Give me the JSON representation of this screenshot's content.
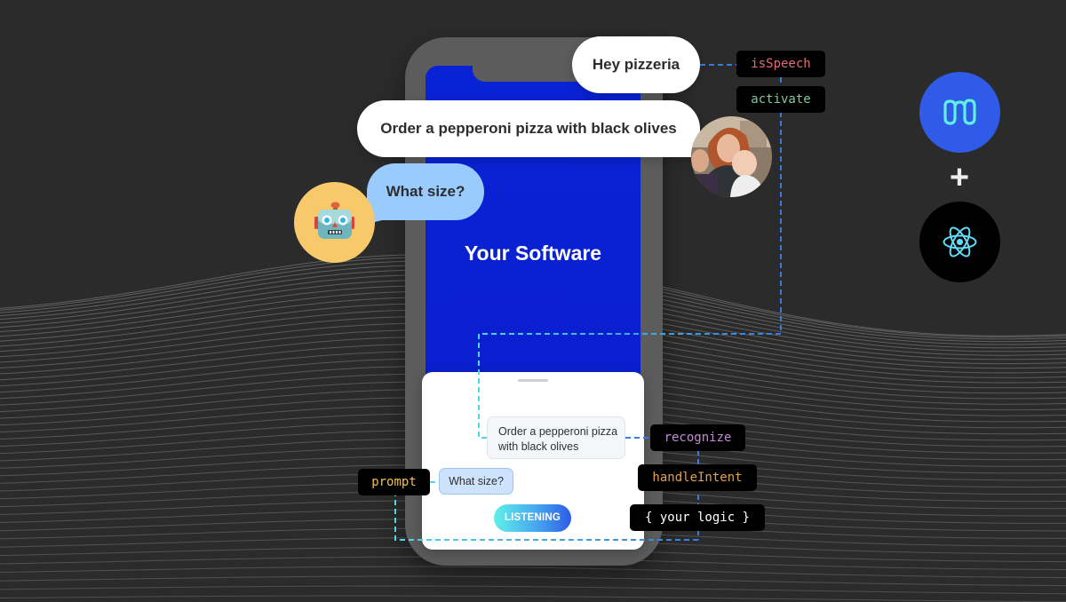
{
  "colors": {
    "background": "#2b2b2b",
    "phone_frame": "#5c5c5c",
    "screen": "#0a22d6",
    "bubble_user": "#ffffff",
    "bubble_bot": "#9acbff",
    "robot_avatar": "#f7c96a",
    "tag_bg": "#000000",
    "isSpeech": "#e06c75",
    "activate": "#7fc99a",
    "recognize": "#c38ad6",
    "handleIntent": "#e3a24a",
    "prompt": "#f0c04a",
    "your_logic": "#ffffff",
    "connector_blue": "#3a7be0",
    "connector_cyan": "#4fd7e8",
    "brand_logo": "#2f5be8",
    "react_logo_bg": "#000000",
    "react_atom": "#61dafb"
  },
  "conversation": {
    "wake_phrase": "Hey pizzeria",
    "user_request": "Order a pepperoni pizza with black olives",
    "bot_question": "What size?"
  },
  "phone": {
    "screen_title": "Your Software",
    "assistant_panel": {
      "user_message_line1": "Order a pepperoni pizza",
      "user_message_line2": "with black olives",
      "bot_message": "What size?",
      "listening_button": "LISTENING"
    }
  },
  "code_tags": {
    "isSpeech": "isSpeech",
    "activate": "activate",
    "recognize": "recognize",
    "handleIntent": "handleIntent",
    "your_logic": "{ your logic }",
    "prompt": "prompt"
  },
  "avatars": {
    "bot": "robot-icon",
    "user": "user-photo"
  },
  "logos": {
    "first": "voice-platform-logo",
    "separator": "+",
    "second": "react-logo"
  }
}
